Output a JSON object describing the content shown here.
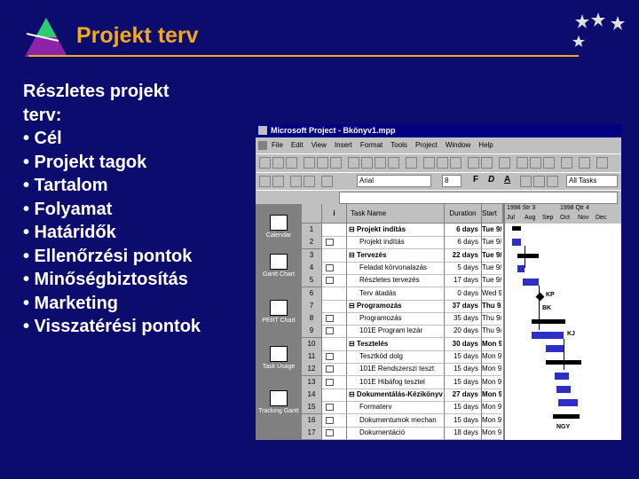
{
  "slide": {
    "title": "Projekt terv",
    "intro": "Részletes projekt terv:",
    "bullets": [
      "• Cél",
      "• Projekt tagok",
      "• Tartalom",
      "• Folyamat",
      "• Határidők",
      "• Ellenőrzési pontok",
      "• Minőségbiztosítás",
      "• Marketing",
      "• Visszatérési pontok"
    ]
  },
  "app": {
    "window_title": "Microsoft Project - Bkönyv1.mpp",
    "menu": [
      "File",
      "Edit",
      "View",
      "Insert",
      "Format",
      "Tools",
      "Project",
      "Window",
      "Help"
    ],
    "font_name": "Arial",
    "font_size": "8",
    "filter": "All Tasks",
    "views": [
      {
        "label": "Calendar",
        "icon": "calendar-icon"
      },
      {
        "label": "Gantt Chart",
        "icon": "gantt-icon"
      },
      {
        "label": "PERT Chart",
        "icon": "pert-icon"
      },
      {
        "label": "Task Usage",
        "icon": "task-usage-icon"
      },
      {
        "label": "Tracking Gantt",
        "icon": "tracking-gantt-icon"
      }
    ],
    "columns": {
      "info": "i",
      "name": "Task Name",
      "duration": "Duration",
      "start": "Start"
    },
    "timescale": {
      "week1": "1998 Str 3",
      "week2": "1998 Qtr 4",
      "months": [
        "Jul",
        "Aug",
        "Sep",
        "Oct",
        "Nov",
        "Dec"
      ]
    },
    "tasks": [
      {
        "id": "1",
        "name": "⊟ Projekt indítás",
        "duration": "6 days",
        "start": "Tue 9/",
        "summary": true
      },
      {
        "id": "2",
        "name": "Projekt indítás",
        "duration": "6 days",
        "start": "Tue 9/",
        "summary": false
      },
      {
        "id": "3",
        "name": "⊟ Tervezés",
        "duration": "22 days",
        "start": "Tue 9/",
        "summary": true
      },
      {
        "id": "4",
        "name": "Feladat körvonalazás",
        "duration": "5 days",
        "start": "Tue 9/",
        "summary": false
      },
      {
        "id": "5",
        "name": "Részletes tervezés",
        "duration": "17 days",
        "start": "Tue 9/",
        "summary": false
      },
      {
        "id": "6",
        "name": "Terv átadás",
        "duration": "0 days",
        "start": "Wed 9/",
        "summary": false
      },
      {
        "id": "7",
        "name": "⊟ Programozás",
        "duration": "37 days",
        "start": "Thu 9/",
        "summary": true
      },
      {
        "id": "8",
        "name": "Programozás",
        "duration": "35 days",
        "start": "Thu 9/",
        "summary": false
      },
      {
        "id": "9",
        "name": "101E Program lezár",
        "duration": "20 days",
        "start": "Thu 9/",
        "summary": false
      },
      {
        "id": "10",
        "name": "⊟ Tesztelés",
        "duration": "30 days",
        "start": "Mon 9/",
        "summary": true
      },
      {
        "id": "11",
        "name": "Tesztkód dolg",
        "duration": "15 days",
        "start": "Mon 9/",
        "summary": false
      },
      {
        "id": "12",
        "name": "101E Rendszerszi teszt",
        "duration": "15 days",
        "start": "Mon 9/",
        "summary": false
      },
      {
        "id": "13",
        "name": "101E Hibáfog tesztel",
        "duration": "15 days",
        "start": "Mon 9/",
        "summary": false
      },
      {
        "id": "14",
        "name": "⊟ Dokumentálás-Kézikönyv",
        "duration": "27 days",
        "start": "Mon 9/",
        "summary": true
      },
      {
        "id": "15",
        "name": "Formaterv",
        "duration": "15 days",
        "start": "Mon 9/",
        "summary": false
      },
      {
        "id": "16",
        "name": "Dokumentumok mechan",
        "duration": "15 days",
        "start": "Mon 9/",
        "summary": false
      },
      {
        "id": "17",
        "name": "Dokumentáció",
        "duration": "18 days",
        "start": "Mon 9/",
        "summary": false
      }
    ],
    "gantt_labels": {
      "kp": "KP",
      "bk": "BK",
      "kj": "KJ",
      "ngy": "NGY"
    }
  },
  "colors": {
    "background": "#0c0c6e",
    "title": "#f1a91f",
    "text": "#ffffff",
    "bar": "#2d2dc8"
  }
}
